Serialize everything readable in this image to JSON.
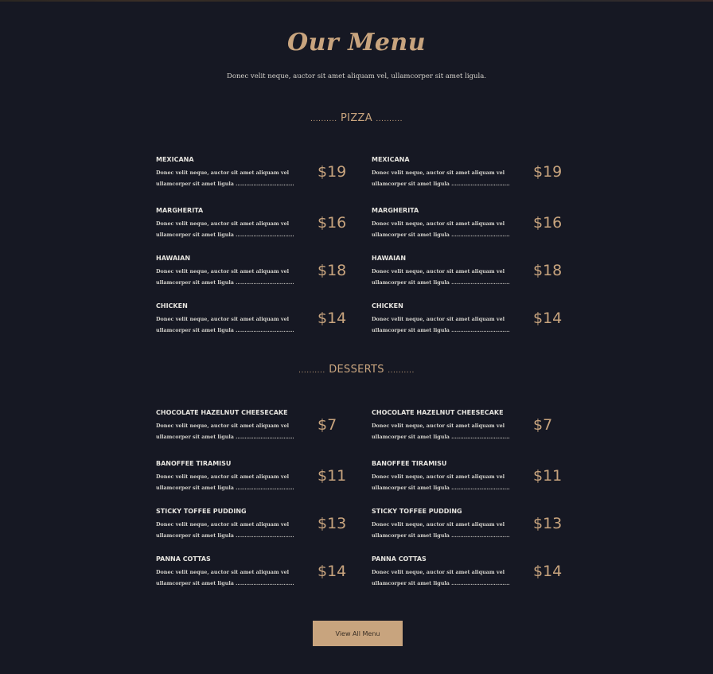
{
  "page": {
    "title": "Our Menu",
    "subtitle": "Donec velit neque, auctor sit amet aliquam vel, ullamcorper sit amet ligula."
  },
  "sections": [
    {
      "heading": "PIZZA",
      "dots_left": "..........",
      "dots_right": "..........",
      "items": [
        {
          "name": "MEXICANA",
          "desc_line1": "Donec velit neque, auctor sit amet aliquam vel",
          "desc_line2": "ullamcorper sit amet ligula .................................",
          "price": "$19"
        },
        {
          "name": "MEXICANA",
          "desc_line1": "Donec velit neque, auctor sit amet aliquam vel",
          "desc_line2": "ullamcorper sit amet ligula .................................",
          "price": "$19"
        },
        {
          "name": "MARGHERITA",
          "desc_line1": "Donec velit neque, auctor sit amet aliquam vel",
          "desc_line2": "ullamcorper sit amet ligula .................................",
          "price": "$16"
        },
        {
          "name": "MARGHERITA",
          "desc_line1": "Donec velit neque, auctor sit amet aliquam vel",
          "desc_line2": "ullamcorper sit amet ligula .................................",
          "price": "$16"
        },
        {
          "name": "HAWAIAN",
          "desc_line1": "Donec velit neque, auctor sit amet aliquam vel",
          "desc_line2": "ullamcorper sit amet ligula .................................",
          "price": "$18"
        },
        {
          "name": "HAWAIAN",
          "desc_line1": "Donec velit neque, auctor sit amet aliquam vel",
          "desc_line2": "ullamcorper sit amet ligula .................................",
          "price": "$18"
        },
        {
          "name": "CHICKEN",
          "desc_line1": "Donec velit neque, auctor sit amet aliquam vel",
          "desc_line2": "ullamcorper sit amet ligula .................................",
          "price": "$14"
        },
        {
          "name": "CHICKEN",
          "desc_line1": "Donec velit neque, auctor sit amet aliquam vel",
          "desc_line2": "ullamcorper sit amet ligula .................................",
          "price": "$14"
        }
      ]
    },
    {
      "heading": "DESSERTS",
      "dots_left": "..........",
      "dots_right": "..........",
      "items": [
        {
          "name": "CHOCOLATE HAZELNUT CHEESECAKE",
          "desc_line1": "Donec velit neque, auctor sit amet aliquam vel",
          "desc_line2": "ullamcorper sit amet ligula .................................",
          "price": "$7"
        },
        {
          "name": "CHOCOLATE HAZELNUT CHEESECAKE",
          "desc_line1": "Donec velit neque, auctor sit amet aliquam vel",
          "desc_line2": "ullamcorper sit amet ligula .................................",
          "price": "$7"
        },
        {
          "name": "BANOFFEE TIRAMISU",
          "desc_line1": "Donec velit neque, auctor sit amet aliquam vel",
          "desc_line2": "ullamcorper sit amet ligula .................................",
          "price": "$11"
        },
        {
          "name": "BANOFFEE TIRAMISU",
          "desc_line1": "Donec velit neque, auctor sit amet aliquam vel",
          "desc_line2": "ullamcorper sit amet ligula .................................",
          "price": "$11"
        },
        {
          "name": "STICKY TOFFEE PUDDING",
          "desc_line1": "Donec velit neque, auctor sit amet aliquam vel",
          "desc_line2": "ullamcorper sit amet ligula .................................",
          "price": "$13"
        },
        {
          "name": "STICKY TOFFEE PUDDING",
          "desc_line1": "Donec velit neque, auctor sit amet aliquam vel",
          "desc_line2": "ullamcorper sit amet ligula .................................",
          "price": "$13"
        },
        {
          "name": "PANNA COTTAS",
          "desc_line1": "Donec velit neque, auctor sit amet aliquam vel",
          "desc_line2": "ullamcorper sit amet ligula .................................",
          "price": "$14"
        },
        {
          "name": "PANNA COTTAS",
          "desc_line1": "Donec velit neque, auctor sit amet aliquam vel",
          "desc_line2": "ullamcorper sit amet ligula .................................",
          "price": "$14"
        }
      ]
    }
  ],
  "cta": {
    "label": "View All Menu"
  },
  "colors": {
    "background": "#161823",
    "accent": "#c8a47e",
    "text": "#e6e4df"
  }
}
